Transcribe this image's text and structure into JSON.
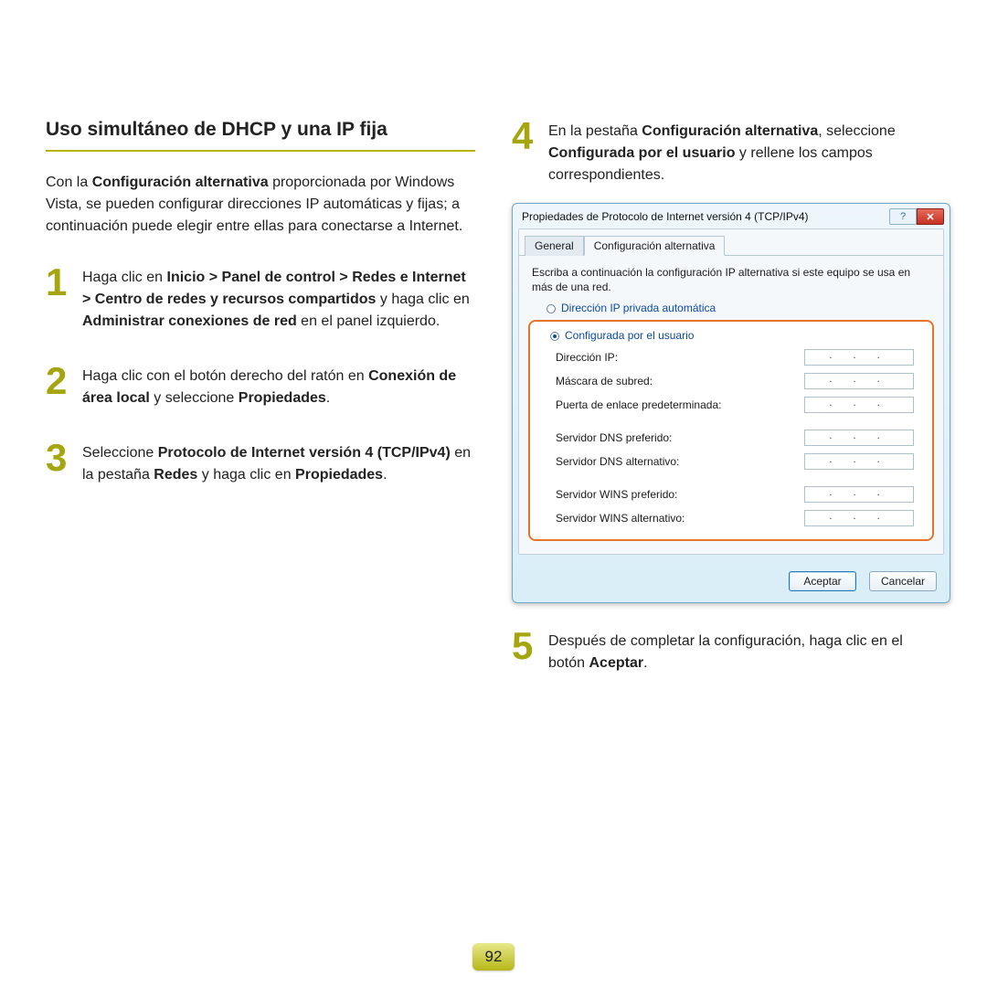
{
  "title": "Uso simultáneo de DHCP y una IP fija",
  "intro": {
    "pre": "Con la ",
    "b1": "Configuración alternativa",
    "post": " proporcionada por Windows Vista, se pueden configurar direcciones IP automáticas y fijas; a continuación puede elegir entre ellas para conectarse a Internet."
  },
  "steps": {
    "s1": {
      "num": "1",
      "t1": "Haga clic en ",
      "b1": "Inicio > Panel de control > Redes e Internet > Centro de redes y recursos compartidos",
      "t2": " y haga clic en ",
      "b2": "Administrar conexiones de red",
      "t3": " en el panel izquierdo."
    },
    "s2": {
      "num": "2",
      "t1": "Haga clic con el botón derecho del ratón en ",
      "b1": "Conexión de área local",
      "t2": " y seleccione ",
      "b2": "Propiedades",
      "t3": "."
    },
    "s3": {
      "num": "3",
      "t1": "Seleccione ",
      "b1": "Protocolo de Internet versión 4 (TCP/IPv4)",
      "t2": " en la pestaña ",
      "b2": "Redes",
      "t3": " y haga clic en ",
      "b3": "Propiedades",
      "t4": "."
    },
    "s4": {
      "num": "4",
      "t1": "En la pestaña ",
      "b1": "Configuración alternativa",
      "t2": ", seleccione ",
      "b2": "Configurada por el usuario",
      "t3": " y rellene los campos correspondientes."
    },
    "s5": {
      "num": "5",
      "t1": "Después de completar la configuración, haga clic en el botón ",
      "b1": "Aceptar",
      "t2": "."
    }
  },
  "dialog": {
    "title": "Propiedades de Protocolo de Internet versión 4 (TCP/IPv4)",
    "help_glyph": "?",
    "close_glyph": "✕",
    "tabs": {
      "general": "General",
      "alt": "Configuración alternativa"
    },
    "description": "Escriba a continuación la configuración IP alternativa si este equipo se usa en más de una red.",
    "radio_auto": "Dirección IP privada automática",
    "radio_user": "Configurada por el usuario",
    "fields": {
      "ip": "Dirección IP:",
      "mask": "Máscara de subred:",
      "gateway": "Puerta de enlace predeterminada:",
      "dns_pref": "Servidor DNS preferido:",
      "dns_alt": "Servidor DNS alternativo:",
      "wins_pref": "Servidor WINS preferido:",
      "wins_alt": "Servidor WINS alternativo:"
    },
    "ip_placeholder": ".  .  .",
    "ok": "Aceptar",
    "cancel": "Cancelar"
  },
  "page_number": "92"
}
